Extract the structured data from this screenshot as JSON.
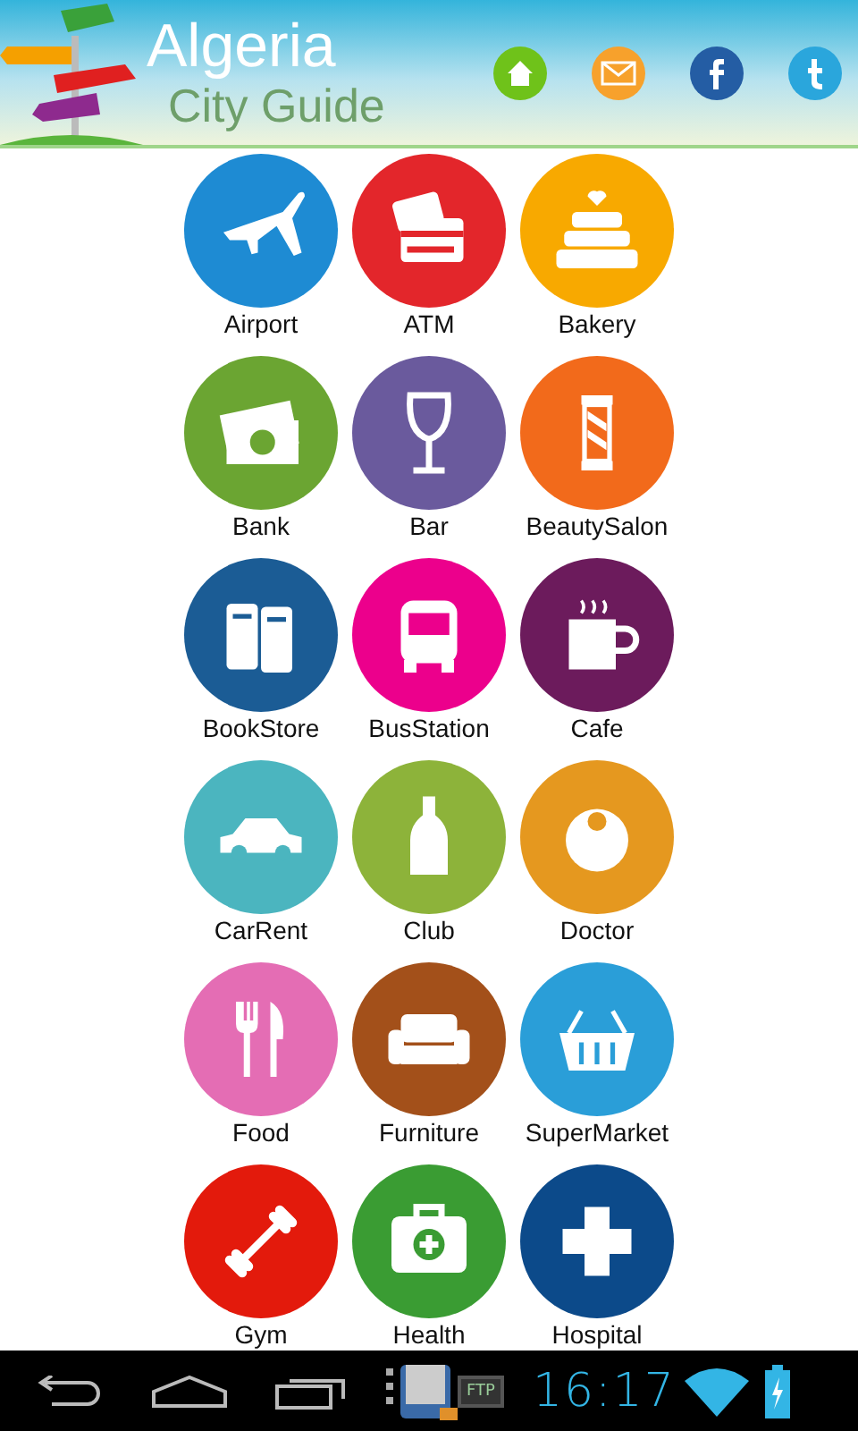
{
  "header": {
    "title": "Algeria",
    "subtitle": "City Guide"
  },
  "categories": [
    {
      "label": "Airport",
      "color": "#1e8bd3"
    },
    {
      "label": "ATM",
      "color": "#e3262b"
    },
    {
      "label": "Bakery",
      "color": "#f8a900"
    },
    {
      "label": "Bank",
      "color": "#6ba532"
    },
    {
      "label": "Bar",
      "color": "#6a5a9d"
    },
    {
      "label": "BeautySalon",
      "color": "#f26a1b"
    },
    {
      "label": "BookStore",
      "color": "#1b5c95"
    },
    {
      "label": "BusStation",
      "color": "#ec008c"
    },
    {
      "label": "Cafe",
      "color": "#6c1b5c"
    },
    {
      "label": "CarRent",
      "color": "#4bb5bf"
    },
    {
      "label": "Club",
      "color": "#8db33a"
    },
    {
      "label": "Doctor",
      "color": "#e5981f"
    },
    {
      "label": "Food",
      "color": "#e46db4"
    },
    {
      "label": "Furniture",
      "color": "#a3501a"
    },
    {
      "label": "SuperMarket",
      "color": "#2a9ed8"
    },
    {
      "label": "Gym",
      "color": "#e31a0c"
    },
    {
      "label": "Health",
      "color": "#3a9c33"
    },
    {
      "label": "Hospital",
      "color": "#0c4a8a"
    }
  ],
  "status_bar": {
    "ftp_label": "FTP",
    "time": "16:17"
  }
}
